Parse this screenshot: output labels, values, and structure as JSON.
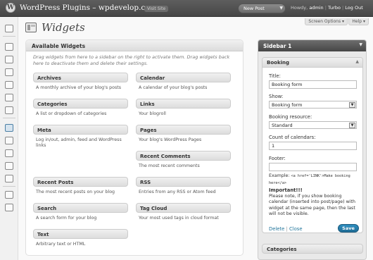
{
  "topbar": {
    "logo_glyph": "W",
    "site_title": "WordPress Plugins – wpdevelop.com...",
    "visit_site": "Visit Site",
    "new_post": "New Post",
    "howdy_prefix": "Howdy,",
    "username": "admin",
    "sep1": "|",
    "turbo": "Turbo",
    "sep2": "|",
    "logout": "Log Out",
    "screen_options": "Screen Options ▾",
    "help": "Help ▾"
  },
  "page": {
    "title": "Widgets"
  },
  "available": {
    "heading": "Available Widgets",
    "description": "Drag widgets from here to a sidebar on the right to activate them. Drag widgets back here to deactivate them and delete their settings.",
    "widgets": [
      {
        "name": "Archives",
        "desc": "A monthly archive of your blog's posts"
      },
      {
        "name": "Calendar",
        "desc": "A calendar of your blog's posts"
      },
      {
        "name": "Categories",
        "desc": "A list or dropdown of categories"
      },
      {
        "name": "Links",
        "desc": "Your blogroll"
      },
      {
        "name": "Meta",
        "desc": "Log in/out, admin, feed and WordPress links"
      },
      {
        "name": "Pages",
        "desc": "Your blog's WordPress Pages"
      },
      {
        "name": "Recent Comments",
        "desc": "The most recent comments"
      },
      {
        "name": "Recent Posts",
        "desc": "The most recent posts on your blog"
      },
      {
        "name": "RSS",
        "desc": "Entries from any RSS or Atom feed"
      },
      {
        "name": "Search",
        "desc": "A search form for your blog"
      },
      {
        "name": "Tag Cloud",
        "desc": "Your most used tags in cloud format"
      },
      {
        "name": "Text",
        "desc": "Arbitrary text or HTML"
      }
    ]
  },
  "sidebar": {
    "heading": "Sidebar 1",
    "booking": {
      "heading": "Booking",
      "title_label": "Title:",
      "title_value": "Booking form",
      "show_label": "Show:",
      "show_value": "Booking form",
      "resource_label": "Booking resource:",
      "resource_value": "Standard",
      "count_label": "Count of calendars:",
      "count_value": "1",
      "footer_label": "Footer:",
      "footer_value": "",
      "example_label": "Example:",
      "example_code": "<a href='LINK'>Make booking here</a>",
      "important_heading": "Important!!!",
      "important_text": "Please note, if you show booking calendar (inserted into post/page) with widget at the same page, then the last will not be visible.",
      "delete": "Delete",
      "link_sep": "|",
      "close": "Close",
      "save": "Save"
    },
    "categories_heading": "Categories"
  }
}
